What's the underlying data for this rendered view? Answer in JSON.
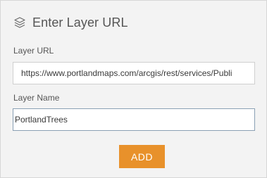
{
  "header": {
    "icon": "layers-icon",
    "title": "Enter Layer URL"
  },
  "form": {
    "url_label": "Layer URL",
    "url_value": "https://www.portlandmaps.com/arcgis/rest/services/Publi",
    "name_label": "Layer Name",
    "name_value": "PortlandTrees",
    "add_label": "ADD"
  },
  "colors": {
    "accent": "#e8912b",
    "panel_bg": "#f3f3f3",
    "text": "#555555"
  }
}
